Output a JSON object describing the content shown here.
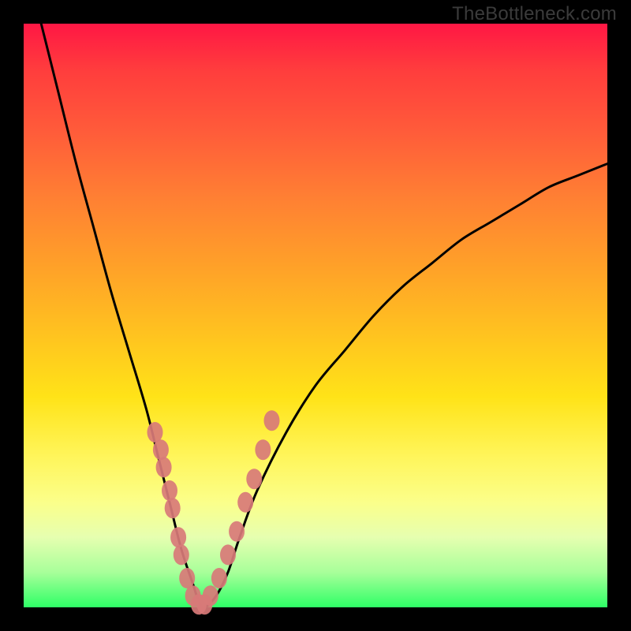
{
  "watermark": "TheBottleneck.com",
  "chart_data": {
    "type": "line",
    "title": "",
    "xlabel": "",
    "ylabel": "",
    "xlim": [
      0,
      100
    ],
    "ylim": [
      0,
      100
    ],
    "series": [
      {
        "name": "bottleneck-curve",
        "x": [
          3,
          6,
          9,
          12,
          15,
          18,
          21,
          23,
          25,
          27,
          29,
          30,
          31,
          33,
          35,
          37,
          40,
          45,
          50,
          55,
          60,
          65,
          70,
          75,
          80,
          85,
          90,
          95,
          100
        ],
        "y": [
          100,
          88,
          76,
          65,
          54,
          44,
          34,
          26,
          18,
          10,
          4,
          1,
          0,
          2,
          6,
          12,
          20,
          30,
          38,
          44,
          50,
          55,
          59,
          63,
          66,
          69,
          72,
          74,
          76
        ]
      }
    ],
    "markers": {
      "name": "sample-points",
      "x": [
        22.5,
        23.5,
        24.0,
        25.0,
        25.5,
        26.5,
        27.0,
        28.0,
        29.0,
        30.0,
        31.0,
        32.0,
        33.5,
        35.0,
        36.5,
        38.0,
        39.5,
        41.0,
        42.5
      ],
      "y": [
        30,
        27,
        24,
        20,
        17,
        12,
        9,
        5,
        2,
        0.5,
        0.5,
        2,
        5,
        9,
        13,
        18,
        22,
        27,
        32
      ]
    },
    "gradient_stops": [
      {
        "pos": 0,
        "color": "#ff1744"
      },
      {
        "pos": 50,
        "color": "#ffd21f"
      },
      {
        "pos": 85,
        "color": "#f7ff7a"
      },
      {
        "pos": 100,
        "color": "#2eff66"
      }
    ]
  }
}
